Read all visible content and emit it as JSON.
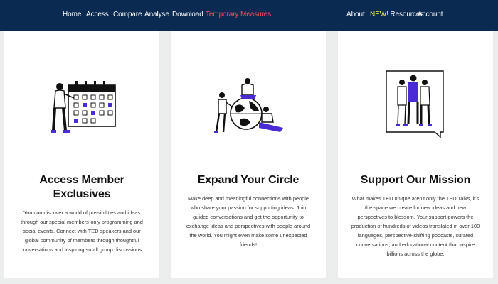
{
  "nav": {
    "left": [
      "Home",
      "Access",
      "Compare",
      "Analyse",
      "Download"
    ],
    "highlight": "Temporary Measures",
    "about": "About",
    "resources_badge": "NEW!",
    "resources_label": " Resources",
    "account": "Account"
  },
  "colors": {
    "nav_bg": "#0b2a52",
    "highlight": "#ff4d5e",
    "badge": "#f2f05a",
    "accent": "#4b2bd6",
    "page_bg": "#eceded"
  },
  "cards": [
    {
      "title_line1": "Access Member",
      "title_line2": "Exclusives",
      "body": "You can discover a world of possibilities and ideas through our special members-only programming and social events. Connect with TED speakers and our global community of members through thoughtful conversations and inspiring small group discussions.",
      "illustration": "calendar-illustration"
    },
    {
      "title": "Expand Your Circle",
      "body": "Make deep and meaningful connections with people who share your passion for supporting ideas. Join guided conversations and get the opportunity to exchange ideas and perspectives with people around the world. You might even make some unexpected friends!",
      "illustration": "globe-people-illustration"
    },
    {
      "title": "Support Our Mission",
      "body": "What makes TED unique aren't only the TED Talks, it's the space we create for new ideas and new perspectives to blossom. Your support powers the production of hundreds of videos translated in over 100 languages, perspective-shifting podcasts, curated conversations, and educational content that inspire billions across the globe.",
      "illustration": "speech-bubble-group-illustration"
    }
  ]
}
